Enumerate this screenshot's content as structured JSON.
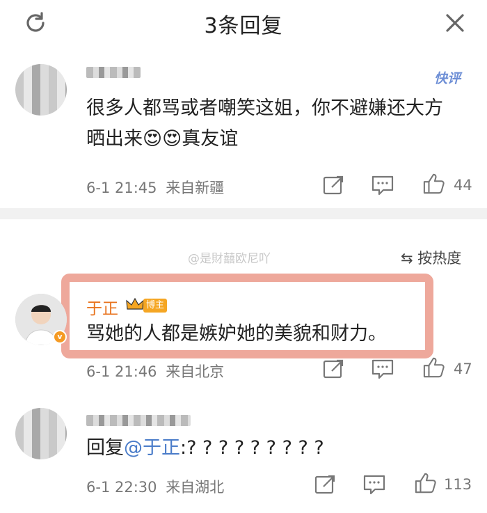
{
  "header": {
    "title": "3条回复"
  },
  "comments": [
    {
      "username_masked": "▓▓▓▓▓",
      "badge": "快评",
      "text_line1": "很多人都骂或者嘲笑这姐，你不避嫌还大方",
      "text_line2": "晒出来",
      "emoji": "😍😍",
      "text_tail": "真友谊",
      "time": "6-1 21:45",
      "source": "来自新疆",
      "likes": "44"
    },
    {
      "username": "于正",
      "role_badge": "博主",
      "text": "骂她的人都是嫉妒她的美貌和财力。",
      "time": "6-1 21:46",
      "source": "来自北京",
      "likes": "47"
    },
    {
      "username_masked": "▓▓▓▓▓▓▓▓",
      "reply_prefix": "回复",
      "reply_at": "@于正",
      "text": ":? ? ? ? ? ? ? ? ?",
      "time": "6-1 22:30",
      "source": "来自湖北",
      "likes": "113"
    }
  ],
  "watermark": "@是財囍欧尼吖",
  "sort_label": "按热度",
  "colors": {
    "highlight": "#eea89b",
    "author_orange": "#e8721c",
    "link_blue": "#4a7cc9",
    "kuaiping_blue": "#6e8fd6"
  }
}
